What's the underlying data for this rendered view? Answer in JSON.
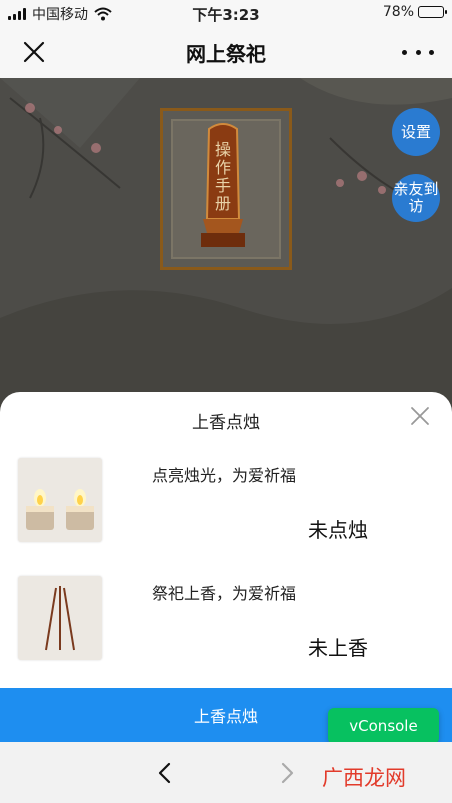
{
  "status_bar": {
    "carrier": "中国移动",
    "time": "下午3:23",
    "battery": "78%",
    "battery_level": 0.78
  },
  "title_bar": {
    "title": "网上祭祀",
    "close_icon": "close-icon",
    "more_icon": "more-dots-icon"
  },
  "scene": {
    "tablet_text": "操作手册",
    "buttons": {
      "settings": "设置",
      "visit": "亲友到访"
    }
  },
  "sheet": {
    "title": "上香点烛",
    "items": [
      {
        "label": "点亮烛光，为爱祈福",
        "status": "未点烛",
        "icon": "candles-icon"
      },
      {
        "label": "祭祀上香，为爱祈福",
        "status": "未上香",
        "icon": "incense-icon"
      }
    ]
  },
  "action_button": "上香点烛",
  "vconsole": "vConsole",
  "watermark": "广西龙网",
  "colors": {
    "primary": "#1e8ef0",
    "round_button": "#2a7bd1",
    "vconsole": "#07c160",
    "scene_bg": "#4d4c48"
  }
}
